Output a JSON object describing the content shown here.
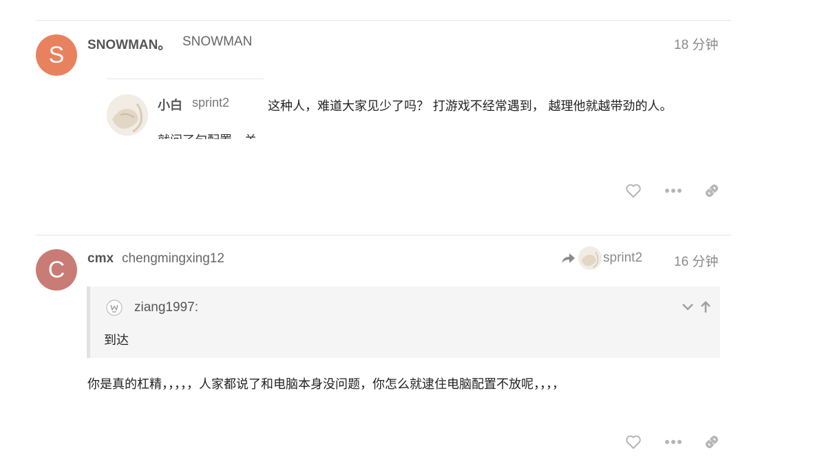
{
  "posts": [
    {
      "avatar_letter": "S",
      "avatar_color": "#e8825e",
      "username": "SNOWMAN。",
      "fullname": "SNOWMAN",
      "time": "18 分钟",
      "embedded_reply": {
        "username": "小白",
        "fullname": "sprint2",
        "text_fragment": "就问了句配置，关"
      },
      "text": "这种人，难道大家见少了吗？ 打游戏不经常遇到， 越理他就越带劲的人。",
      "actions": {
        "like_icon": "heart-icon",
        "more_icon": "ellipsis-icon",
        "share_icon": "link-icon"
      }
    },
    {
      "avatar_letter": "C",
      "avatar_color": "#c97b76",
      "username": "cmx",
      "fullname": "chengmingxing12",
      "reply_to": "sprint2",
      "time": "16 分钟",
      "quote": {
        "author": "ziang1997:",
        "text": "到达"
      },
      "text": "你是真的杠精，，，，，人家都说了和电脑本身没问题，你怎么就逮住电脑配置不放呢，，，，",
      "actions": {
        "like_icon": "heart-icon",
        "more_icon": "ellipsis-icon",
        "share_icon": "link-icon"
      }
    }
  ]
}
